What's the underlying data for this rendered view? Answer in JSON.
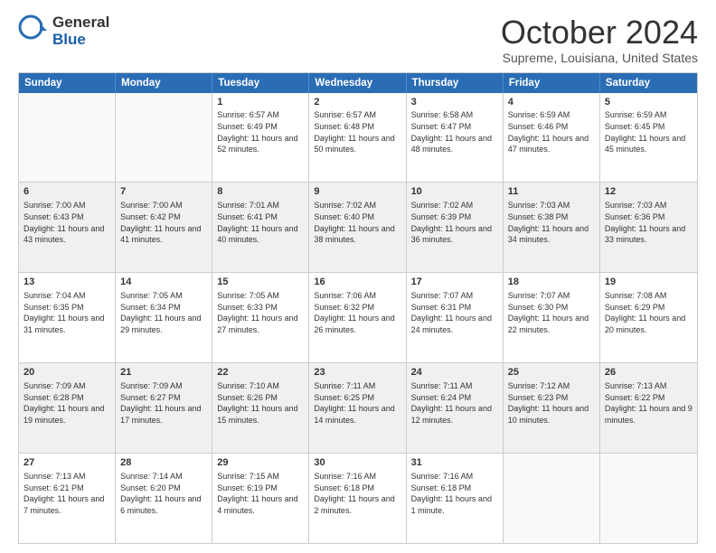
{
  "header": {
    "logo_general": "General",
    "logo_blue": "Blue",
    "month_title": "October 2024",
    "subtitle": "Supreme, Louisiana, United States"
  },
  "days_of_week": [
    "Sunday",
    "Monday",
    "Tuesday",
    "Wednesday",
    "Thursday",
    "Friday",
    "Saturday"
  ],
  "weeks": [
    [
      {
        "day": "",
        "info": ""
      },
      {
        "day": "",
        "info": ""
      },
      {
        "day": "1",
        "info": "Sunrise: 6:57 AM\nSunset: 6:49 PM\nDaylight: 11 hours\nand 52 minutes."
      },
      {
        "day": "2",
        "info": "Sunrise: 6:57 AM\nSunset: 6:48 PM\nDaylight: 11 hours\nand 50 minutes."
      },
      {
        "day": "3",
        "info": "Sunrise: 6:58 AM\nSunset: 6:47 PM\nDaylight: 11 hours\nand 48 minutes."
      },
      {
        "day": "4",
        "info": "Sunrise: 6:59 AM\nSunset: 6:46 PM\nDaylight: 11 hours\nand 47 minutes."
      },
      {
        "day": "5",
        "info": "Sunrise: 6:59 AM\nSunset: 6:45 PM\nDaylight: 11 hours\nand 45 minutes."
      }
    ],
    [
      {
        "day": "6",
        "info": "Sunrise: 7:00 AM\nSunset: 6:43 PM\nDaylight: 11 hours\nand 43 minutes."
      },
      {
        "day": "7",
        "info": "Sunrise: 7:00 AM\nSunset: 6:42 PM\nDaylight: 11 hours\nand 41 minutes."
      },
      {
        "day": "8",
        "info": "Sunrise: 7:01 AM\nSunset: 6:41 PM\nDaylight: 11 hours\nand 40 minutes."
      },
      {
        "day": "9",
        "info": "Sunrise: 7:02 AM\nSunset: 6:40 PM\nDaylight: 11 hours\nand 38 minutes."
      },
      {
        "day": "10",
        "info": "Sunrise: 7:02 AM\nSunset: 6:39 PM\nDaylight: 11 hours\nand 36 minutes."
      },
      {
        "day": "11",
        "info": "Sunrise: 7:03 AM\nSunset: 6:38 PM\nDaylight: 11 hours\nand 34 minutes."
      },
      {
        "day": "12",
        "info": "Sunrise: 7:03 AM\nSunset: 6:36 PM\nDaylight: 11 hours\nand 33 minutes."
      }
    ],
    [
      {
        "day": "13",
        "info": "Sunrise: 7:04 AM\nSunset: 6:35 PM\nDaylight: 11 hours\nand 31 minutes."
      },
      {
        "day": "14",
        "info": "Sunrise: 7:05 AM\nSunset: 6:34 PM\nDaylight: 11 hours\nand 29 minutes."
      },
      {
        "day": "15",
        "info": "Sunrise: 7:05 AM\nSunset: 6:33 PM\nDaylight: 11 hours\nand 27 minutes."
      },
      {
        "day": "16",
        "info": "Sunrise: 7:06 AM\nSunset: 6:32 PM\nDaylight: 11 hours\nand 26 minutes."
      },
      {
        "day": "17",
        "info": "Sunrise: 7:07 AM\nSunset: 6:31 PM\nDaylight: 11 hours\nand 24 minutes."
      },
      {
        "day": "18",
        "info": "Sunrise: 7:07 AM\nSunset: 6:30 PM\nDaylight: 11 hours\nand 22 minutes."
      },
      {
        "day": "19",
        "info": "Sunrise: 7:08 AM\nSunset: 6:29 PM\nDaylight: 11 hours\nand 20 minutes."
      }
    ],
    [
      {
        "day": "20",
        "info": "Sunrise: 7:09 AM\nSunset: 6:28 PM\nDaylight: 11 hours\nand 19 minutes."
      },
      {
        "day": "21",
        "info": "Sunrise: 7:09 AM\nSunset: 6:27 PM\nDaylight: 11 hours\nand 17 minutes."
      },
      {
        "day": "22",
        "info": "Sunrise: 7:10 AM\nSunset: 6:26 PM\nDaylight: 11 hours\nand 15 minutes."
      },
      {
        "day": "23",
        "info": "Sunrise: 7:11 AM\nSunset: 6:25 PM\nDaylight: 11 hours\nand 14 minutes."
      },
      {
        "day": "24",
        "info": "Sunrise: 7:11 AM\nSunset: 6:24 PM\nDaylight: 11 hours\nand 12 minutes."
      },
      {
        "day": "25",
        "info": "Sunrise: 7:12 AM\nSunset: 6:23 PM\nDaylight: 11 hours\nand 10 minutes."
      },
      {
        "day": "26",
        "info": "Sunrise: 7:13 AM\nSunset: 6:22 PM\nDaylight: 11 hours\nand 9 minutes."
      }
    ],
    [
      {
        "day": "27",
        "info": "Sunrise: 7:13 AM\nSunset: 6:21 PM\nDaylight: 11 hours\nand 7 minutes."
      },
      {
        "day": "28",
        "info": "Sunrise: 7:14 AM\nSunset: 6:20 PM\nDaylight: 11 hours\nand 6 minutes."
      },
      {
        "day": "29",
        "info": "Sunrise: 7:15 AM\nSunset: 6:19 PM\nDaylight: 11 hours\nand 4 minutes."
      },
      {
        "day": "30",
        "info": "Sunrise: 7:16 AM\nSunset: 6:18 PM\nDaylight: 11 hours\nand 2 minutes."
      },
      {
        "day": "31",
        "info": "Sunrise: 7:16 AM\nSunset: 6:18 PM\nDaylight: 11 hours\nand 1 minute."
      },
      {
        "day": "",
        "info": ""
      },
      {
        "day": "",
        "info": ""
      }
    ]
  ]
}
